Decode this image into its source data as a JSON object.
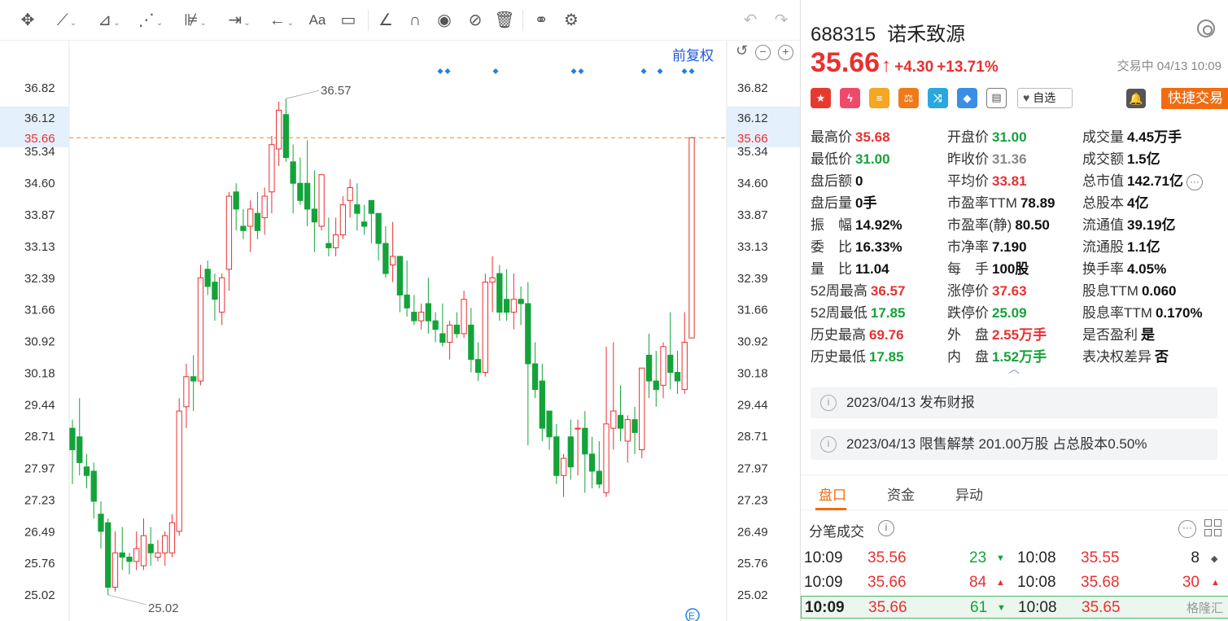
{
  "chart": {
    "restore_label": "前复权",
    "marker_e": "E",
    "high_annotation": "36.57",
    "low_annotation": "25.02",
    "current_price_label": "35.66",
    "highlight_price_label": "36.12",
    "y_ticks": [
      "36.82",
      "36.12",
      "35.34",
      "34.60",
      "33.87",
      "33.13",
      "32.39",
      "31.66",
      "30.92",
      "30.18",
      "29.44",
      "28.71",
      "27.97",
      "27.23",
      "26.49",
      "25.76",
      "25.02"
    ],
    "colors": {
      "up": "#e93030",
      "down": "#14a33a",
      "marker": "#1f7fe0",
      "dash": "#f0a040"
    }
  },
  "chart_data": {
    "type": "candlestick",
    "y_range": [
      25.02,
      36.82
    ],
    "candles": [
      {
        "o": 28.9,
        "h": 29.1,
        "l": 27.6,
        "c": 28.4
      },
      {
        "o": 28.7,
        "h": 29.6,
        "l": 27.8,
        "c": 28.1
      },
      {
        "o": 28.0,
        "h": 28.3,
        "l": 27.5,
        "c": 27.8
      },
      {
        "o": 27.9,
        "h": 28.1,
        "l": 26.8,
        "c": 27.2
      },
      {
        "o": 26.9,
        "h": 27.2,
        "l": 26.1,
        "c": 26.5
      },
      {
        "o": 26.7,
        "h": 26.8,
        "l": 25.02,
        "c": 25.2
      },
      {
        "o": 25.2,
        "h": 26.5,
        "l": 25.1,
        "c": 26.0
      },
      {
        "o": 26.0,
        "h": 26.6,
        "l": 25.6,
        "c": 25.9
      },
      {
        "o": 25.9,
        "h": 26.0,
        "l": 25.5,
        "c": 25.8
      },
      {
        "o": 25.8,
        "h": 26.5,
        "l": 25.6,
        "c": 26.1
      },
      {
        "o": 25.7,
        "h": 26.8,
        "l": 25.6,
        "c": 26.4
      },
      {
        "o": 26.2,
        "h": 26.6,
        "l": 25.7,
        "c": 26.0
      },
      {
        "o": 25.9,
        "h": 26.3,
        "l": 25.8,
        "c": 26.0
      },
      {
        "o": 26.0,
        "h": 26.5,
        "l": 25.7,
        "c": 26.4
      },
      {
        "o": 26.0,
        "h": 26.9,
        "l": 25.9,
        "c": 26.7
      },
      {
        "o": 26.5,
        "h": 29.6,
        "l": 26.4,
        "c": 29.3
      },
      {
        "o": 29.4,
        "h": 30.4,
        "l": 28.9,
        "c": 30.1
      },
      {
        "o": 30.1,
        "h": 30.6,
        "l": 29.3,
        "c": 30.0
      },
      {
        "o": 30.0,
        "h": 32.7,
        "l": 29.9,
        "c": 32.4
      },
      {
        "o": 32.6,
        "h": 32.8,
        "l": 32.0,
        "c": 32.2
      },
      {
        "o": 32.3,
        "h": 32.5,
        "l": 31.4,
        "c": 31.9
      },
      {
        "o": 31.6,
        "h": 32.5,
        "l": 31.3,
        "c": 32.4
      },
      {
        "o": 32.6,
        "h": 34.4,
        "l": 32.1,
        "c": 34.3
      },
      {
        "o": 34.4,
        "h": 34.6,
        "l": 33.5,
        "c": 34.0
      },
      {
        "o": 33.6,
        "h": 34.0,
        "l": 33.3,
        "c": 33.5
      },
      {
        "o": 33.6,
        "h": 34.2,
        "l": 33.0,
        "c": 34.0
      },
      {
        "o": 33.9,
        "h": 34.4,
        "l": 33.3,
        "c": 33.5
      },
      {
        "o": 33.8,
        "h": 34.5,
        "l": 33.4,
        "c": 34.3
      },
      {
        "o": 34.4,
        "h": 35.7,
        "l": 33.9,
        "c": 35.5
      },
      {
        "o": 35.4,
        "h": 36.5,
        "l": 35.0,
        "c": 36.3
      },
      {
        "o": 36.2,
        "h": 36.57,
        "l": 35.1,
        "c": 35.2
      },
      {
        "o": 35.1,
        "h": 35.5,
        "l": 33.9,
        "c": 34.6
      },
      {
        "o": 34.6,
        "h": 35.2,
        "l": 34.1,
        "c": 34.2
      },
      {
        "o": 34.6,
        "h": 35.6,
        "l": 33.6,
        "c": 34.0
      },
      {
        "o": 34.0,
        "h": 34.9,
        "l": 33.0,
        "c": 33.7
      },
      {
        "o": 33.6,
        "h": 34.8,
        "l": 33.5,
        "c": 34.8
      },
      {
        "o": 33.2,
        "h": 33.8,
        "l": 32.9,
        "c": 33.1
      },
      {
        "o": 33.1,
        "h": 33.8,
        "l": 32.9,
        "c": 33.4
      },
      {
        "o": 33.4,
        "h": 34.3,
        "l": 33.3,
        "c": 34.1
      },
      {
        "o": 34.2,
        "h": 34.7,
        "l": 33.8,
        "c": 34.5
      },
      {
        "o": 34.1,
        "h": 34.6,
        "l": 33.5,
        "c": 33.9
      },
      {
        "o": 33.7,
        "h": 34.1,
        "l": 33.4,
        "c": 33.6
      },
      {
        "o": 34.2,
        "h": 34.2,
        "l": 33.2,
        "c": 33.9
      },
      {
        "o": 33.9,
        "h": 33.7,
        "l": 32.8,
        "c": 33.2
      },
      {
        "o": 33.2,
        "h": 33.6,
        "l": 32.4,
        "c": 32.5
      },
      {
        "o": 32.7,
        "h": 33.7,
        "l": 32.3,
        "c": 32.9
      },
      {
        "o": 32.9,
        "h": 32.3,
        "l": 31.6,
        "c": 32.0
      },
      {
        "o": 32.0,
        "h": 32.8,
        "l": 31.5,
        "c": 31.7
      },
      {
        "o": 31.6,
        "h": 32.0,
        "l": 31.3,
        "c": 31.4
      },
      {
        "o": 31.4,
        "h": 31.8,
        "l": 31.2,
        "c": 31.6
      },
      {
        "o": 31.8,
        "h": 32.4,
        "l": 31.1,
        "c": 31.4
      },
      {
        "o": 31.4,
        "h": 31.6,
        "l": 30.9,
        "c": 31.2
      },
      {
        "o": 31.1,
        "h": 31.8,
        "l": 30.8,
        "c": 30.9
      },
      {
        "o": 30.9,
        "h": 31.4,
        "l": 30.5,
        "c": 31.3
      },
      {
        "o": 31.3,
        "h": 31.6,
        "l": 31.0,
        "c": 31.1
      },
      {
        "o": 31.1,
        "h": 32.1,
        "l": 31.0,
        "c": 31.9
      },
      {
        "o": 31.3,
        "h": 31.7,
        "l": 30.2,
        "c": 30.5
      },
      {
        "o": 30.5,
        "h": 30.9,
        "l": 30.0,
        "c": 30.2
      },
      {
        "o": 30.2,
        "h": 32.5,
        "l": 30.1,
        "c": 32.3
      },
      {
        "o": 32.3,
        "h": 32.9,
        "l": 31.6,
        "c": 32.4
      },
      {
        "o": 32.5,
        "h": 32.7,
        "l": 31.4,
        "c": 31.6
      },
      {
        "o": 31.9,
        "h": 32.6,
        "l": 31.4,
        "c": 31.6
      },
      {
        "o": 31.6,
        "h": 32.5,
        "l": 31.2,
        "c": 31.9
      },
      {
        "o": 31.9,
        "h": 32.2,
        "l": 31.3,
        "c": 31.8
      },
      {
        "o": 31.8,
        "h": 32.3,
        "l": 28.5,
        "c": 30.4
      },
      {
        "o": 30.4,
        "h": 30.9,
        "l": 29.6,
        "c": 29.8
      },
      {
        "o": 30.0,
        "h": 30.4,
        "l": 28.6,
        "c": 28.9
      },
      {
        "o": 29.3,
        "h": 29.3,
        "l": 28.4,
        "c": 28.7
      },
      {
        "o": 28.7,
        "h": 29.0,
        "l": 27.6,
        "c": 27.8
      },
      {
        "o": 27.8,
        "h": 28.3,
        "l": 27.3,
        "c": 28.2
      },
      {
        "o": 28.7,
        "h": 29.1,
        "l": 27.7,
        "c": 28.0
      },
      {
        "o": 28.9,
        "h": 29.1,
        "l": 27.8,
        "c": 28.9
      },
      {
        "o": 28.9,
        "h": 29.3,
        "l": 27.4,
        "c": 28.3
      },
      {
        "o": 28.3,
        "h": 28.7,
        "l": 27.5,
        "c": 27.9
      },
      {
        "o": 27.9,
        "h": 28.6,
        "l": 27.5,
        "c": 27.6
      },
      {
        "o": 27.4,
        "h": 30.8,
        "l": 27.3,
        "c": 29.0
      },
      {
        "o": 28.9,
        "h": 30.9,
        "l": 28.4,
        "c": 29.3
      },
      {
        "o": 29.2,
        "h": 29.9,
        "l": 28.6,
        "c": 28.9
      },
      {
        "o": 28.6,
        "h": 29.2,
        "l": 28.1,
        "c": 29.1
      },
      {
        "o": 29.1,
        "h": 29.4,
        "l": 28.3,
        "c": 28.8
      },
      {
        "o": 28.4,
        "h": 30.3,
        "l": 28.2,
        "c": 30.3
      },
      {
        "o": 30.6,
        "h": 31.1,
        "l": 29.6,
        "c": 30.0
      },
      {
        "o": 30.0,
        "h": 30.7,
        "l": 29.4,
        "c": 29.8
      },
      {
        "o": 29.9,
        "h": 30.9,
        "l": 29.6,
        "c": 30.8
      },
      {
        "o": 30.6,
        "h": 31.6,
        "l": 29.8,
        "c": 30.2
      },
      {
        "o": 30.2,
        "h": 30.7,
        "l": 29.7,
        "c": 30.0
      },
      {
        "o": 29.8,
        "h": 31.6,
        "l": 29.7,
        "c": 30.9
      },
      {
        "o": 31.0,
        "h": 35.68,
        "l": 31.0,
        "c": 35.66
      }
    ],
    "high_marker": 36.57,
    "low_marker": 25.02,
    "current": 35.66
  },
  "stock": {
    "code": "688315",
    "name": "诺禾致源",
    "price": "35.66",
    "change": "+4.30",
    "change_pct": "+13.71%",
    "status": "交易中 04/13 10:09",
    "watch_label": "自选",
    "quick_trade_label": "快捷交易"
  },
  "stats": [
    {
      "label": "最高价",
      "value": "35.68",
      "color": "red"
    },
    {
      "label": "开盘价",
      "value": "31.00",
      "color": "green"
    },
    {
      "label": "成交量",
      "value": "4.45万手",
      "color": "black"
    },
    {
      "label": "最低价",
      "value": "31.00",
      "color": "green"
    },
    {
      "label": "昨收价",
      "value": "31.36",
      "color": "grey"
    },
    {
      "label": "成交额",
      "value": "1.5亿",
      "color": "black"
    },
    {
      "label": "盘后额",
      "value": "0",
      "color": "black"
    },
    {
      "label": "平均价",
      "value": "33.81",
      "color": "red"
    },
    {
      "label": "总市值",
      "value": "142.71亿",
      "color": "black"
    },
    {
      "label": "盘后量",
      "value": "0手",
      "color": "black"
    },
    {
      "label": "市盈率TTM",
      "value": "78.89",
      "color": "black"
    },
    {
      "label": "总股本",
      "value": "4亿",
      "color": "black"
    },
    {
      "label": "振　幅",
      "value": "14.92%",
      "color": "black"
    },
    {
      "label": "市盈率(静)",
      "value": "80.50",
      "color": "black"
    },
    {
      "label": "流通值",
      "value": "39.19亿",
      "color": "black"
    },
    {
      "label": "委　比",
      "value": "16.33%",
      "color": "black"
    },
    {
      "label": "市净率",
      "value": "7.190",
      "color": "black"
    },
    {
      "label": "流通股",
      "value": "1.1亿",
      "color": "black"
    },
    {
      "label": "量　比",
      "value": "11.04",
      "color": "black"
    },
    {
      "label": "每　手",
      "value": "100股",
      "color": "black"
    },
    {
      "label": "换手率",
      "value": "4.05%",
      "color": "black"
    },
    {
      "label": "52周最高",
      "value": "36.57",
      "color": "red"
    },
    {
      "label": "涨停价",
      "value": "37.63",
      "color": "red"
    },
    {
      "label": "股息TTM",
      "value": "0.060",
      "color": "black"
    },
    {
      "label": "52周最低",
      "value": "17.85",
      "color": "green"
    },
    {
      "label": "跌停价",
      "value": "25.09",
      "color": "green"
    },
    {
      "label": "股息率TTM",
      "value": "0.170%",
      "color": "black"
    },
    {
      "label": "历史最高",
      "value": "69.76",
      "color": "red"
    },
    {
      "label": "外　盘",
      "value": "2.55万手",
      "color": "red"
    },
    {
      "label": "是否盈利",
      "value": "是",
      "color": "black"
    },
    {
      "label": "历史最低",
      "value": "17.85",
      "color": "green"
    },
    {
      "label": "内　盘",
      "value": "1.52万手",
      "color": "green"
    },
    {
      "label": "表决权差异",
      "value": "否",
      "color": "black"
    }
  ],
  "notices": [
    {
      "text": "2023/04/13  发布财报"
    },
    {
      "text": "2023/04/13  限售解禁 201.00万股 占总股本0.50%"
    }
  ],
  "tabs": [
    {
      "label": "盘口"
    },
    {
      "label": "资金"
    },
    {
      "label": "异动"
    }
  ],
  "ticks": {
    "title": "分笔成交",
    "rows": [
      {
        "t1": "10:09",
        "p1": "35.56",
        "v1": "23",
        "d1": "down",
        "t2": "10:08",
        "p2": "35.55",
        "v2": "8",
        "d2": "flat"
      },
      {
        "t1": "10:09",
        "p1": "35.66",
        "v1": "84",
        "d1": "up",
        "t2": "10:08",
        "p2": "35.68",
        "v2": "30",
        "d2": "up"
      },
      {
        "t1": "10:09",
        "p1": "35.66",
        "v1": "61",
        "d1": "down",
        "t2": "10:08",
        "p2": "35.65",
        "v2": "",
        "d2": ""
      }
    ]
  },
  "watermark": "格隆汇"
}
